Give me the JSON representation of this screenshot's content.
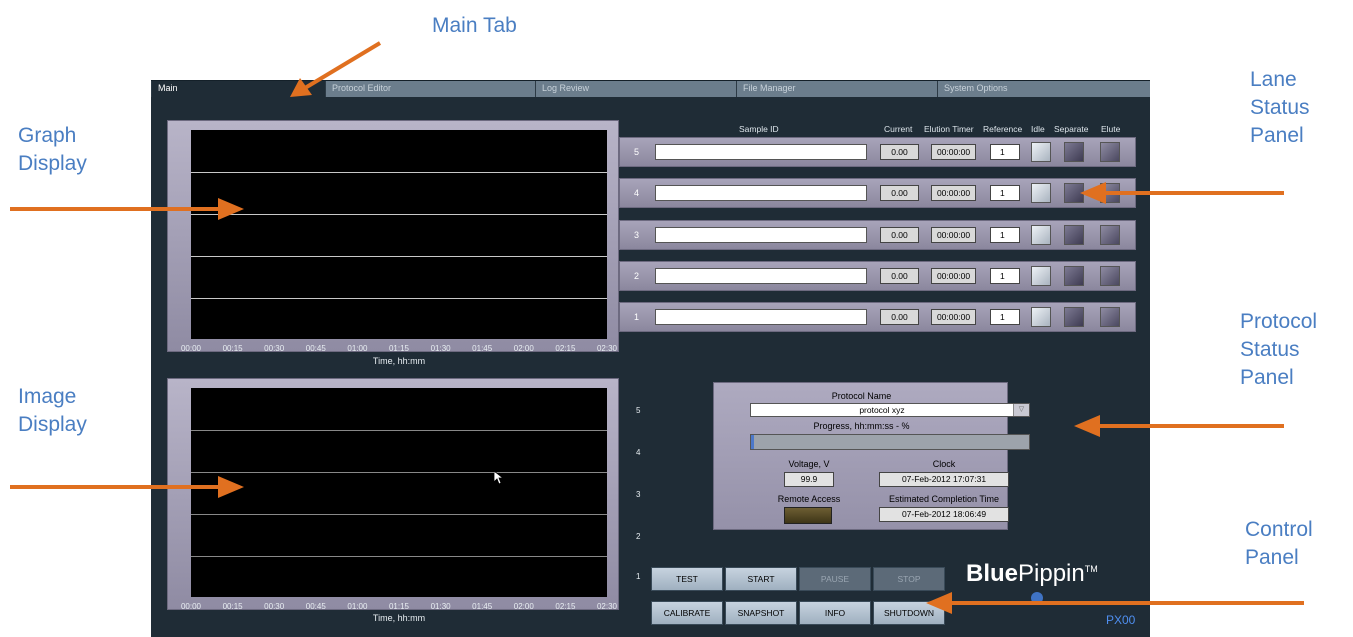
{
  "callouts": {
    "main_tab": "Main Tab",
    "graph_display": [
      "Graph",
      "Display"
    ],
    "image_display": [
      "Image",
      "Display"
    ],
    "lane_status": [
      "Lane",
      "Status",
      "Panel"
    ],
    "protocol_status": [
      "Protocol",
      "Status",
      "Panel"
    ],
    "control_panel": [
      "Control",
      "Panel"
    ]
  },
  "tabs": [
    "Main",
    "Protocol Editor",
    "Log Review",
    "File Manager",
    "System Options"
  ],
  "graph": {
    "ticks": [
      "00:00",
      "00:15",
      "00:30",
      "00:45",
      "01:00",
      "01:15",
      "01:30",
      "01:45",
      "02:00",
      "02:15",
      "02:30"
    ],
    "xlabel": "Time, hh:mm"
  },
  "image_display": {
    "ticks": [
      "00:00",
      "00:15",
      "00:30",
      "00:45",
      "01:00",
      "01:15",
      "01:30",
      "01:45",
      "02:00",
      "02:15",
      "02:30"
    ],
    "xlabel": "Time, hh:mm",
    "lane_markers": [
      "5",
      "4",
      "3",
      "2",
      "1"
    ]
  },
  "lane_headers": {
    "sample_id": "Sample ID",
    "current": "Current",
    "elution_timer": "Elution Timer",
    "reference": "Reference",
    "idle": "Idle",
    "separate": "Separate",
    "elute": "Elute"
  },
  "lanes": [
    {
      "num": "5",
      "sample_id": "",
      "current": "0.00",
      "timer": "00:00:00",
      "reference": "1"
    },
    {
      "num": "4",
      "sample_id": "",
      "current": "0.00",
      "timer": "00:00:00",
      "reference": "1"
    },
    {
      "num": "3",
      "sample_id": "",
      "current": "0.00",
      "timer": "00:00:00",
      "reference": "1"
    },
    {
      "num": "2",
      "sample_id": "",
      "current": "0.00",
      "timer": "00:00:00",
      "reference": "1"
    },
    {
      "num": "1",
      "sample_id": "",
      "current": "0.00",
      "timer": "00:00:00",
      "reference": "1"
    }
  ],
  "protocol": {
    "name_label": "Protocol Name",
    "name_value": "protocol xyz",
    "progress_label": "Progress, hh:mm:ss - %",
    "progress_value": 0.01,
    "voltage_label": "Voltage, V",
    "voltage_value": "99.9",
    "clock_label": "Clock",
    "clock_value": "07-Feb-2012   17:07:31",
    "remote_label": "Remote Access",
    "completion_label": "Estimated Completion Time",
    "completion_value": "07-Feb-2012   18:06:49"
  },
  "controls": {
    "test": "TEST",
    "start": "START",
    "pause": "PAUSE",
    "stop": "STOP",
    "calibrate": "CALIBRATE",
    "snapshot": "SNAPSHOT",
    "info": "INFO",
    "shutdown": "SHUTDOWN"
  },
  "logo": {
    "blue": "Blue",
    "pippin": "Pippin",
    "tm": "TM",
    "model": "PX00"
  },
  "colors": {
    "callout_text": "#4a7ec2",
    "arrow": "#e07020",
    "app_bg": "#1f2c36"
  }
}
